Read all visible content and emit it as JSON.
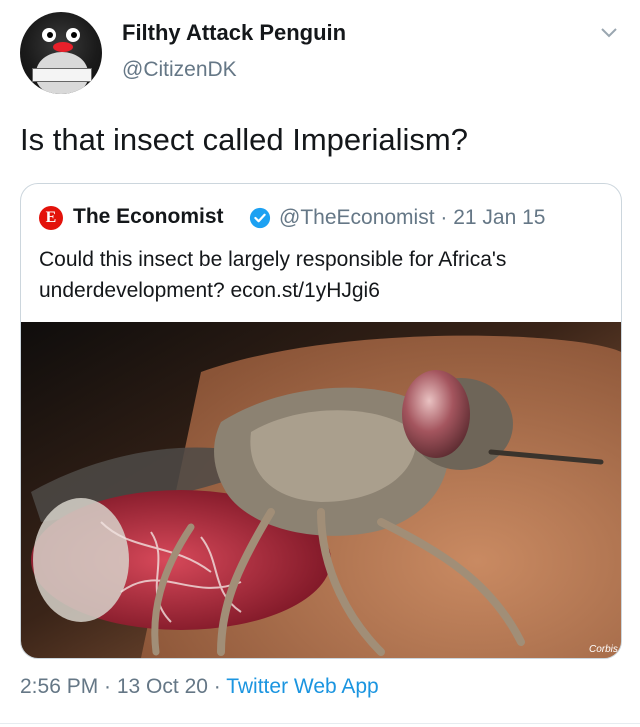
{
  "author": {
    "name": "Filthy Attack Penguin",
    "handle": "@CitizenDK"
  },
  "tweet": {
    "text": "Is that insect called Imperialism?"
  },
  "quoted": {
    "logo_letter": "E",
    "name": "The Economist",
    "handle_date": "@TheEconomist · 21 Jan 15",
    "text": "Could this insect be largely responsible for Africa's underdevelopment? econ.st/1yHJgi6",
    "image_watermark": "Corbis"
  },
  "meta": {
    "time_date": "2:56 PM · 13 Oct 20 · ",
    "source": "Twitter Web App"
  },
  "colors": {
    "link": "#1b95e0",
    "verified": "#1da1f2",
    "economist_red": "#e3120b",
    "muted": "#657786"
  },
  "icons": {
    "menu": "chevron-down-icon",
    "verified": "verified-badge-icon"
  }
}
